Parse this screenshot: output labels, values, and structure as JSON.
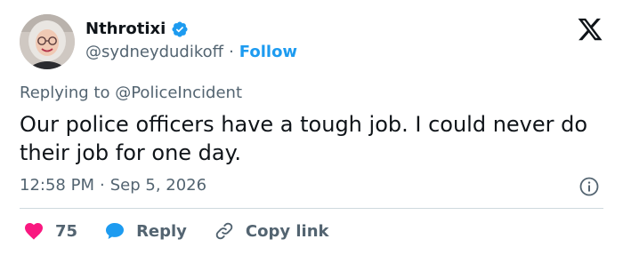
{
  "author": {
    "display_name": "Nthrotixi",
    "handle": "@sydneydudikoff",
    "separator": "·",
    "follow_label": "Follow"
  },
  "tweet": {
    "replying_prefix": "Replying to",
    "replying_to": "@PoliceIncident",
    "text": "Our police officers have a tough job. I could never do  their job for one day.",
    "time": "12:58 PM",
    "meta_separator": "·",
    "date": "Sep 5, 2026"
  },
  "actions": {
    "like_count": "75",
    "reply_label": "Reply",
    "copy_link_label": "Copy link"
  },
  "icons": {
    "logo": "x-logo-icon",
    "verified": "verified-badge-icon",
    "info": "info-icon",
    "like": "heart-icon",
    "reply": "speech-bubble-icon",
    "copy": "link-icon"
  },
  "colors": {
    "accent": "#1d9bf0",
    "like": "#f91880",
    "text_primary": "#0f1419",
    "text_secondary": "#536471",
    "divider": "#cfd9de"
  }
}
